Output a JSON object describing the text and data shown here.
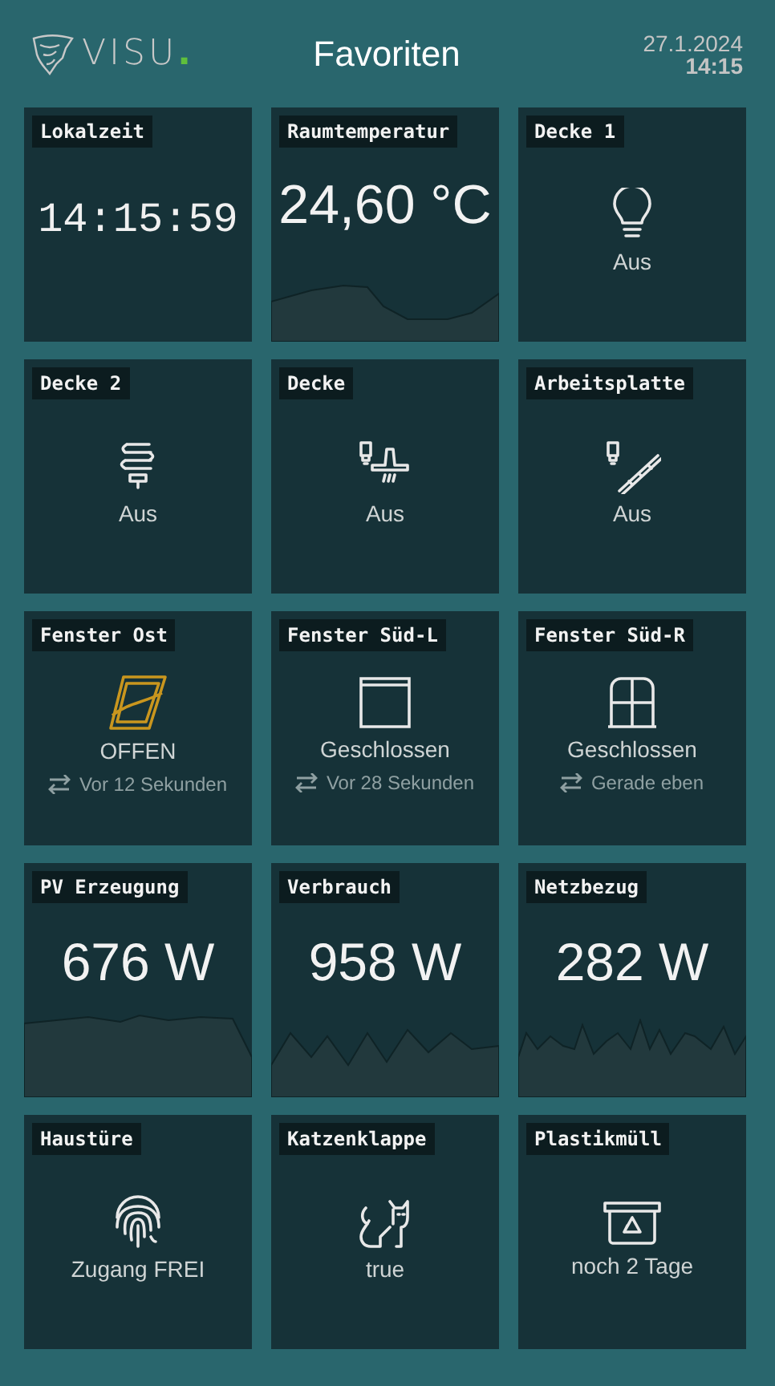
{
  "header": {
    "logo": {
      "text": "VISU",
      "dot": "."
    },
    "title": "Favoriten",
    "date": "27.1.2024",
    "time": "14:15"
  },
  "tiles": [
    {
      "kind": "clock",
      "label": "Lokalzeit",
      "value": "14:15:59"
    },
    {
      "kind": "value",
      "label": "Raumtemperatur",
      "value": "24,60 °C"
    },
    {
      "kind": "status",
      "label": "Decke 1",
      "state": "Aus"
    },
    {
      "kind": "status",
      "label": "Decke 2",
      "state": "Aus"
    },
    {
      "kind": "status",
      "label": "Decke",
      "state": "Aus"
    },
    {
      "kind": "status",
      "label": "Arbeitsplatte",
      "state": "Aus"
    },
    {
      "kind": "status",
      "label": "Fenster Ost",
      "state": "OFFEN",
      "open": true,
      "changed": "Vor 12 Sekunden"
    },
    {
      "kind": "status",
      "label": "Fenster Süd-L",
      "state": "Geschlossen",
      "open": false,
      "changed": "Vor 28 Sekunden"
    },
    {
      "kind": "status",
      "label": "Fenster Süd-R",
      "state": "Geschlossen",
      "open": false,
      "changed": "Gerade eben"
    },
    {
      "kind": "value",
      "label": "PV Erzeugung",
      "value": "676 W"
    },
    {
      "kind": "value",
      "label": "Verbrauch",
      "value": "958 W"
    },
    {
      "kind": "value",
      "label": "Netzbezug",
      "value": "282 W"
    },
    {
      "kind": "status",
      "label": "Haustüre",
      "state": "Zugang FREI"
    },
    {
      "kind": "status",
      "label": "Katzenklappe",
      "state": "true"
    },
    {
      "kind": "status",
      "label": "Plastikmüll",
      "state": "noch 2 Tage"
    }
  ]
}
